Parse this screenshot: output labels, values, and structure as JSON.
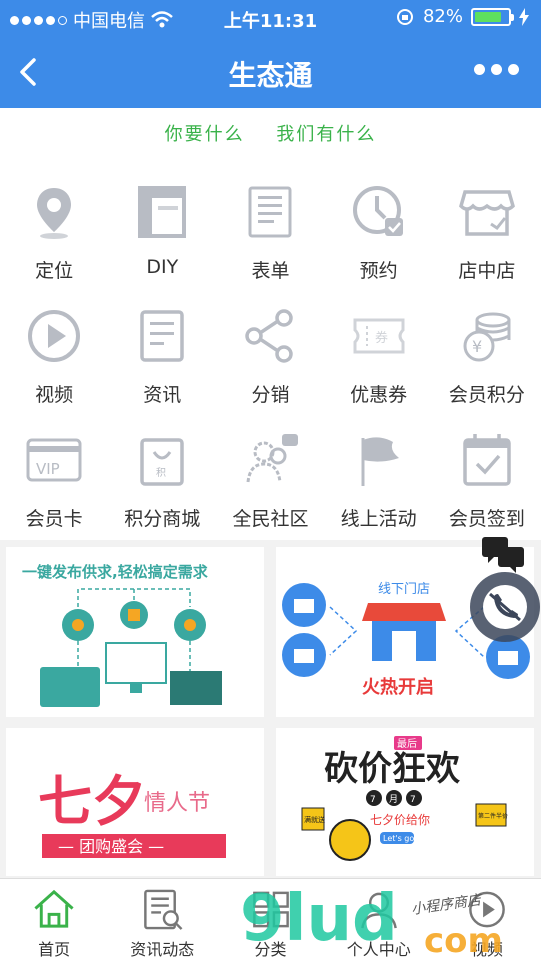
{
  "status_bar": {
    "carrier": "中国电信",
    "time": "上午11:31",
    "battery": "82%",
    "battery_level": 0.82
  },
  "nav": {
    "title": "生态通"
  },
  "slogan": {
    "left": "你要什么",
    "right": "我们有什么"
  },
  "features": [
    [
      {
        "label": "定位",
        "icon": "location-icon"
      },
      {
        "label": "DIY",
        "icon": "layout-icon"
      },
      {
        "label": "表单",
        "icon": "form-icon"
      },
      {
        "label": "预约",
        "icon": "clock-icon"
      },
      {
        "label": "店中店",
        "icon": "store-icon"
      }
    ],
    [
      {
        "label": "视频",
        "icon": "play-icon"
      },
      {
        "label": "资讯",
        "icon": "news-icon"
      },
      {
        "label": "分销",
        "icon": "share-icon"
      },
      {
        "label": "优惠券",
        "icon": "coupon-icon"
      },
      {
        "label": "会员积分",
        "icon": "coins-icon"
      }
    ],
    [
      {
        "label": "会员卡",
        "icon": "vip-card-icon"
      },
      {
        "label": "积分商城",
        "icon": "shopping-bag-icon"
      },
      {
        "label": "全民社区",
        "icon": "community-icon"
      },
      {
        "label": "线上活动",
        "icon": "flag-icon"
      },
      {
        "label": "会员签到",
        "icon": "calendar-check-icon"
      }
    ]
  ],
  "banners": {
    "supply": {
      "headline": "一键发布供求,轻松搞定需求"
    },
    "store": {
      "tag": "线下门店",
      "headline": "火热开启"
    },
    "qixi": {
      "headline": "七夕",
      "script": "情人节",
      "sub": "— 团购盛会 —"
    },
    "bargain": {
      "badge": "最后",
      "headline": "砍价狂欢",
      "date": [
        "7",
        "月",
        "7"
      ],
      "sub": "七夕价给你",
      "go": "Let's go",
      "left_tag": "满就送",
      "right_tag": "第二件半价"
    }
  },
  "tabbar": [
    {
      "label": "首页",
      "icon": "home-icon"
    },
    {
      "label": "资讯动态",
      "icon": "news-search-icon"
    },
    {
      "label": "分类",
      "icon": "category-icon"
    },
    {
      "label": "个人中心",
      "icon": "user-icon"
    },
    {
      "label": "视频",
      "icon": "video-icon"
    }
  ],
  "watermark": {
    "text": "9lud",
    "suffix": "com",
    "script": "小程序商店"
  },
  "colors": {
    "primary": "#3d8be8",
    "slogan": "#3ab24a",
    "icon": "#b8bcc4",
    "red": "#e83a3a",
    "teal": "#3aa8a0"
  }
}
